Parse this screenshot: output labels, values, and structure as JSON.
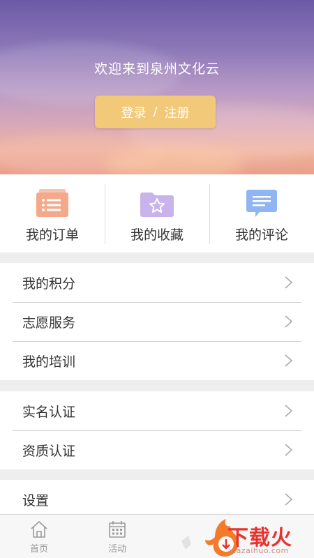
{
  "header": {
    "welcome": "欢迎来到泉州文化云",
    "login_label": "登录",
    "separator": "/",
    "register_label": "注册"
  },
  "quick_actions": [
    {
      "label": "我的订单",
      "icon": "order-list-icon",
      "color": "#f4a98a"
    },
    {
      "label": "我的收藏",
      "icon": "favorite-folder-icon",
      "color": "#c9b3ec"
    },
    {
      "label": "我的评论",
      "icon": "comment-bubble-icon",
      "color": "#8fb6f2"
    }
  ],
  "menu_group1": [
    {
      "label": "我的积分"
    },
    {
      "label": "志愿服务"
    },
    {
      "label": "我的培训"
    }
  ],
  "menu_group2": [
    {
      "label": "实名认证"
    },
    {
      "label": "资质认证"
    }
  ],
  "menu_group3": [
    {
      "label": "设置"
    }
  ],
  "tabbar": [
    {
      "label": "首页",
      "icon": "home-icon"
    },
    {
      "label": "活动",
      "icon": "calendar-icon"
    }
  ],
  "watermark": {
    "brand": "下载火",
    "url": "xiazaihuo.com"
  },
  "colors": {
    "accent_button": "#f2c978",
    "watermark_red": "#e8322e"
  }
}
